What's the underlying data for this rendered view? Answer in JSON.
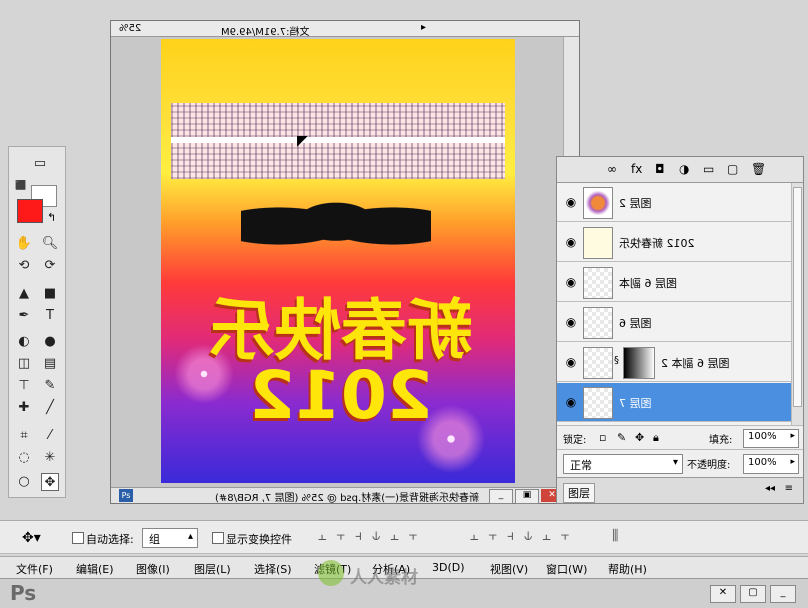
{
  "app": {
    "logo": "Ps"
  },
  "menu": {
    "items": [
      "文件(F)",
      "编辑(E)",
      "图像(I)",
      "图层(L)",
      "选择(S)",
      "滤镜(T)",
      "分析(A)",
      "3D(D)",
      "视图(V)",
      "窗口(W)",
      "帮助(H)"
    ]
  },
  "options": {
    "auto_select_label": "自动选择:",
    "auto_select_value": "组",
    "show_transform_label": "显示变换控件"
  },
  "doc": {
    "title": "新春快乐海报背景(一)素材.psd @ 25% (图层 7, RGB/8#)",
    "zoom": "25%",
    "status": "文档:7.91M/49.9M",
    "poster_main": "新春快乐",
    "poster_year": "2012"
  },
  "layers": {
    "tab": "图层",
    "blend_mode": "正常",
    "opacity_label": "不透明度:",
    "opacity_value": "100%",
    "lock_label": "锁定:",
    "fill_label": "填充:",
    "fill_value": "100%",
    "items": [
      {
        "name": "图层 2"
      },
      {
        "name": "2012 新春快乐"
      },
      {
        "name": "图层 6 副本"
      },
      {
        "name": "图层 6"
      },
      {
        "name": "图层 6 副本 2"
      },
      {
        "name": "图层 7"
      }
    ]
  },
  "colors": {
    "foreground": "#ff1a1a",
    "selection": "#4b8fe0"
  },
  "watermark": "人人素材"
}
